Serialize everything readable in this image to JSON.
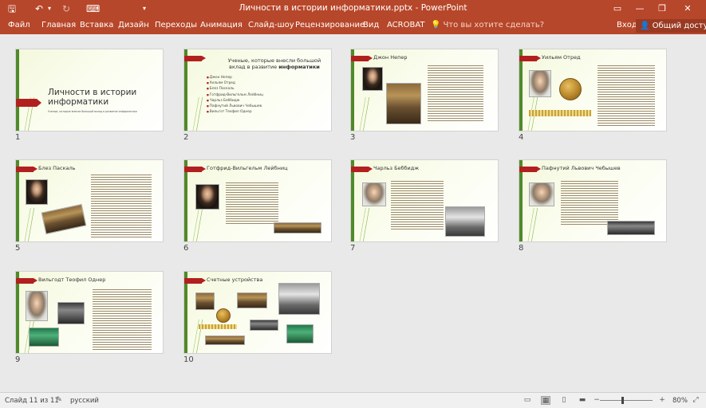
{
  "window": {
    "title": "Личности в истории информатики.pptx - PowerPoint",
    "quick_access": {
      "save": "🖫",
      "undo": "↶",
      "undo_arrow": "▾",
      "redo": "↻",
      "touch": "⌨",
      "customize": "▾"
    },
    "controls": {
      "ribbon_display": "▭",
      "minimize": "—",
      "restore": "❐",
      "close": "✕"
    }
  },
  "ribbon": {
    "tabs": [
      "Файл",
      "Главная",
      "Вставка",
      "Дизайн",
      "Переходы",
      "Анимация",
      "Слайд-шоу",
      "Рецензирование",
      "Вид",
      "ACROBAT"
    ],
    "tell_me": "Что вы хотите сделать?",
    "tell_me_icon": "lightbulb-icon",
    "sign_in": "Вход",
    "share": "Общий доступ",
    "share_icon": "person-icon"
  },
  "slides": [
    {
      "number": "1",
      "title": "Личности в истории информатики",
      "subtitle": "Ученые, которые внесли большой вклад в развитие информатики"
    },
    {
      "number": "2",
      "title_part1": "Ученые, которые внесли большой вклад в развитие",
      "title_part2": "информатики",
      "items": [
        "Джон Непер",
        "Уильям Отред",
        "Блез Паскаль",
        "Готфрид-Вильгельм Лейбниц",
        "Чарльз Беббидж",
        "Пафнутий Львович Чебышев",
        "Вильгот Теофил Однер"
      ]
    },
    {
      "number": "3",
      "title": "Джон Непер"
    },
    {
      "number": "4",
      "title": "Уильям Отред"
    },
    {
      "number": "5",
      "title": "Блез Паскаль"
    },
    {
      "number": "6",
      "title": "Готфрид-Вильгельм Лейбниц"
    },
    {
      "number": "7",
      "title": "Чарльз Беббидж"
    },
    {
      "number": "8",
      "title": "Пафнутий Львович Чебышев"
    },
    {
      "number": "9",
      "title": "Вильгодт Теофил Однер"
    },
    {
      "number": "10",
      "title": "Счетные устройства"
    }
  ],
  "statusbar": {
    "slide_count": "Слайд 11 из 11",
    "language": "русский",
    "zoom": "80%",
    "zoom_minus": "−",
    "zoom_plus": "+"
  },
  "colors": {
    "accent": "#b7472a",
    "slide_bar": "#4f8a2a",
    "slide_flag": "#b21f1f"
  }
}
